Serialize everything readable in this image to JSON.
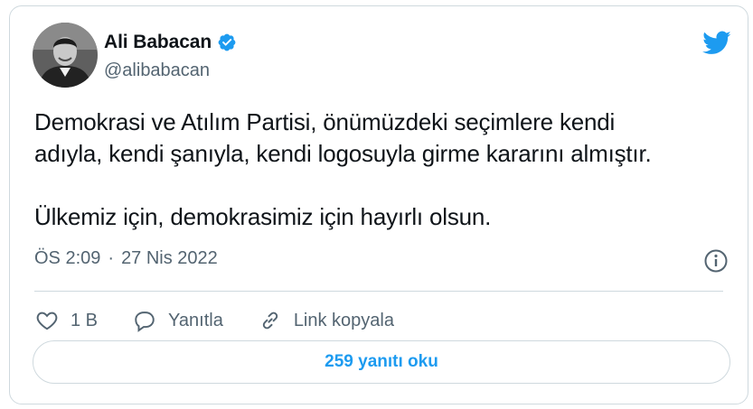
{
  "author": {
    "name": "Ali Babacan",
    "handle": "@alibabacan",
    "verified": true
  },
  "tweet": {
    "lines": [
      "Demokrasi ve Atılım Partisi, önümüzdeki seçimlere kendi",
      "adıyla, kendi şanıyla, kendi logosuyla girme kararını almıştır.",
      "Ülkemiz için, demokrasimiz için hayırlı olsun."
    ],
    "time": "ÖS 2:09",
    "separator": "·",
    "date": "27 Nis 2022"
  },
  "actions": {
    "likes": "1 B",
    "reply_label": "Yanıtla",
    "copy_link_label": "Link kopyala"
  },
  "read_replies_label": "259 yanıtı oku",
  "colors": {
    "accent": "#1d9bf0",
    "text": "#0f1419",
    "secondary": "#536471",
    "border": "#cfd9de"
  },
  "icons": [
    "verified-badge-icon",
    "twitter-bird-icon",
    "info-icon",
    "heart-icon",
    "reply-bubble-icon",
    "link-icon"
  ]
}
